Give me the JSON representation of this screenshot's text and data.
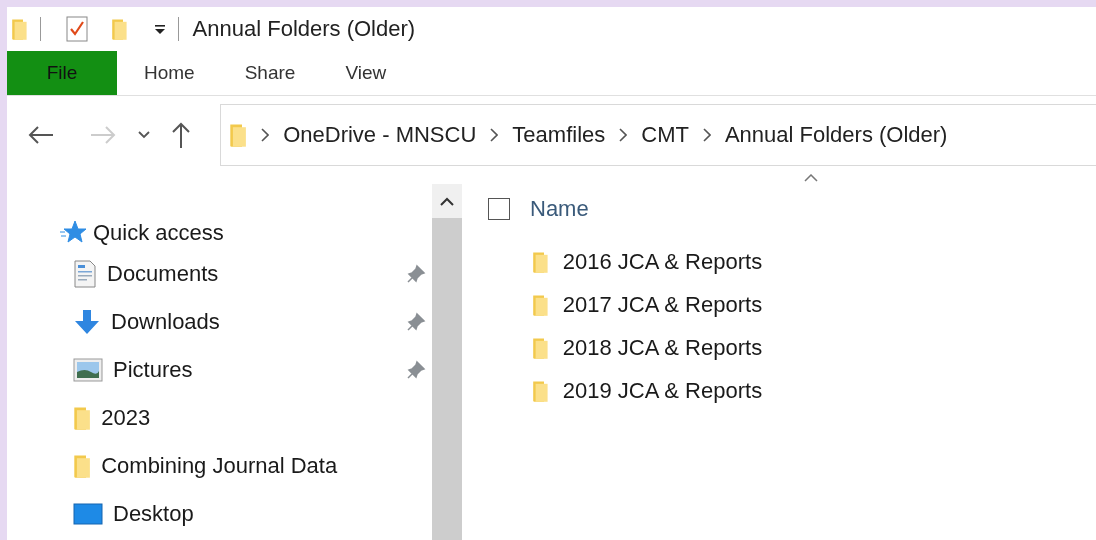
{
  "window": {
    "title": "Annual Folders (Older)"
  },
  "ribbon": {
    "tabs": [
      {
        "label": "File",
        "selected": true
      },
      {
        "label": "Home",
        "selected": false
      },
      {
        "label": "Share",
        "selected": false
      },
      {
        "label": "View",
        "selected": false
      }
    ]
  },
  "address_bar": {
    "breadcrumbs": [
      "OneDrive - MNSCU",
      "Teamfiles",
      "CMT",
      "Annual Folders (Older)"
    ]
  },
  "sidebar": {
    "header": "Quick access",
    "items": [
      {
        "label": "Documents",
        "kind": "documents",
        "pinned": true
      },
      {
        "label": "Downloads",
        "kind": "downloads",
        "pinned": true
      },
      {
        "label": "Pictures",
        "kind": "pictures",
        "pinned": true
      },
      {
        "label": "2023",
        "kind": "folder",
        "pinned": false
      },
      {
        "label": "Combining Journal Data",
        "kind": "folder",
        "pinned": false
      },
      {
        "label": "Desktop",
        "kind": "desktop",
        "pinned": false
      }
    ]
  },
  "file_list": {
    "column": "Name",
    "select_all_checked": false,
    "rows": [
      {
        "name": "2016 JCA & Reports"
      },
      {
        "name": "2017 JCA & Reports"
      },
      {
        "name": "2018 JCA & Reports"
      },
      {
        "name": "2019 JCA & Reports"
      }
    ]
  }
}
